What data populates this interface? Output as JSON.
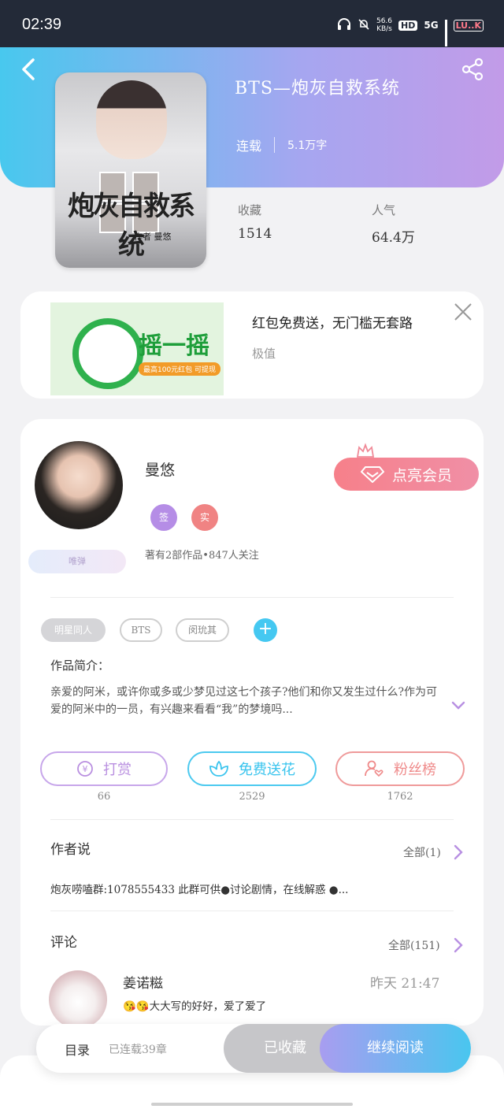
{
  "status_bar": {
    "time": "02:39",
    "net_speed_value": "56.6",
    "net_speed_unit": "KB/s",
    "hd": "HD",
    "network": "5G",
    "battery": "LU..K"
  },
  "book": {
    "title": "BTS—炮灰自救系统",
    "status": "连载",
    "word_count": "5.1万字",
    "stats": [
      {
        "label": "收藏",
        "value": "1514"
      },
      {
        "label": "人气",
        "value": "64.4万"
      }
    ],
    "cover": {
      "big_text": "炮灰自救系统",
      "author_text": "作者 曼悠"
    }
  },
  "ad": {
    "image_text": "摇一摇",
    "image_pill": "最高100元红包 可提现",
    "title": "红包免费送，无门槛无套路",
    "source": "极值"
  },
  "author": {
    "name": "曼悠",
    "badges": [
      "签",
      "实"
    ],
    "meta": "著有2部作品•847人关注",
    "fan_badge": "唯弹",
    "vip_label": "点亮会员"
  },
  "tags": [
    "明星同人",
    "BTS",
    "闵玧其"
  ],
  "intro": {
    "heading": "作品简介：",
    "text": "亲爱的阿米，或许你或多或少梦见过这七个孩子?他们和你又发生过什么?作为可爱的阿米中的一员，有兴趣来看看“我”的梦境吗..."
  },
  "actions": [
    {
      "label": "打赏",
      "count": "66",
      "color": "#b98fe0"
    },
    {
      "label": "免费送花",
      "count": "2529",
      "color": "#39c4ee"
    },
    {
      "label": "粉丝榜",
      "count": "1762",
      "color": "#ef8a8a"
    }
  ],
  "author_says": {
    "heading": "作者说",
    "all_label": "全部(1)",
    "text": "炮灰唠嗑群:1078555433 此群可供●讨论剧情，在线解惑 ●..."
  },
  "comments": {
    "heading": "评论",
    "all_label": "全部(151)",
    "items": [
      {
        "user": "姜诺糍",
        "time": "昨天 21:47",
        "text": "😘😘大大写的好好，爱了爱了"
      }
    ]
  },
  "bottom_bar": {
    "toc": "目录",
    "chapters": "已连载39章",
    "favorited": "已收藏",
    "continue": "继续阅读"
  },
  "colors": {
    "header_gradient": [
      "#48c8ee",
      "#c29be8"
    ],
    "vip": "#f6808a",
    "accent_blue": "#45c8f1",
    "badge_purple": "#b58de6",
    "badge_red": "#f08383"
  }
}
